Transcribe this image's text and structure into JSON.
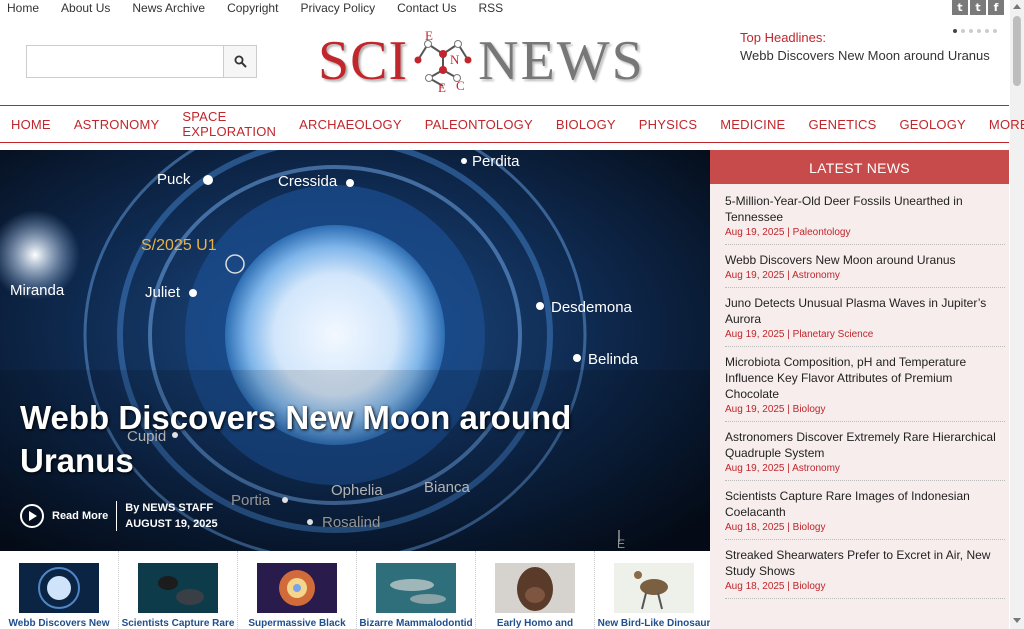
{
  "topbar": {
    "links": [
      "Home",
      "About Us",
      "News Archive",
      "Copyright",
      "Privacy Policy",
      "Contact Us",
      "RSS"
    ],
    "social": [
      {
        "icon": "twitter-icon",
        "glyph": "t"
      },
      {
        "icon": "tumblr-icon",
        "glyph": "t"
      },
      {
        "icon": "facebook-icon",
        "glyph": "f"
      }
    ]
  },
  "search": {
    "placeholder": "",
    "button_icon": "search-icon"
  },
  "logo": {
    "left": "SCI",
    "molecule_letters": [
      "E",
      "N",
      "C",
      "E"
    ],
    "right": "NEWS"
  },
  "headlines": {
    "label": "Top Headlines:",
    "text": "Webb Discovers New Moon around Uranus"
  },
  "nav": [
    "HOME",
    "ASTRONOMY",
    "SPACE EXPLORATION",
    "ARCHAEOLOGY",
    "PALEONTOLOGY",
    "BIOLOGY",
    "PHYSICS",
    "MEDICINE",
    "GENETICS",
    "GEOLOGY",
    "MORE"
  ],
  "hero": {
    "title": "Webb Discovers New Moon around Uranus",
    "read_more": "Read More",
    "byline": "By NEWS STAFF",
    "date": "AUGUST 19, 2025",
    "image_labels": {
      "puck": "Puck",
      "cressida": "Cressida",
      "perdita": "Perdita",
      "new_moon": "S/2025 U1",
      "miranda": "Miranda",
      "juliet": "Juliet",
      "desdemona": "Desdemona",
      "belinda": "Belinda",
      "cupid": "Cupid",
      "ophelia": "Ophelia",
      "bianca": "Bianca",
      "portia": "Portia",
      "rosalind": "Rosalind",
      "compass_e": "E"
    }
  },
  "latest": {
    "heading": "LATEST NEWS",
    "items": [
      {
        "title": "5-Million-Year-Old Deer Fossils Unearthed in Tennessee",
        "meta": "Aug 19, 2025 | Paleontology"
      },
      {
        "title": "Webb Discovers New Moon around Uranus",
        "meta": "Aug 19, 2025 | Astronomy"
      },
      {
        "title": "Juno Detects Unusual Plasma Waves in Jupiter’s Aurora",
        "meta": "Aug 19, 2025 | Planetary Science"
      },
      {
        "title": "Microbiota Composition, pH and Temperature Influence Key Flavor Attributes of Premium Chocolate",
        "meta": "Aug 19, 2025 | Biology"
      },
      {
        "title": "Astronomers Discover Extremely Rare Hierarchical Quadruple System",
        "meta": "Aug 19, 2025 | Astronomy"
      },
      {
        "title": "Scientists Capture Rare Images of Indonesian Coelacanth",
        "meta": "Aug 18, 2025 | Biology"
      },
      {
        "title": "Streaked Shearwaters Prefer to Excret in Air, New Study Shows",
        "meta": "Aug 18, 2025 | Biology"
      }
    ]
  },
  "thumbs": [
    {
      "caption": "Webb Discovers New",
      "kind": "uranus"
    },
    {
      "caption": "Scientists Capture Rare",
      "kind": "diver"
    },
    {
      "caption": "Supermassive Black",
      "kind": "nebula"
    },
    {
      "caption": "Bizarre Mammalodontid",
      "kind": "whale"
    },
    {
      "caption": "Early Homo and",
      "kind": "hominid"
    },
    {
      "caption": "New Bird-Like Dinosaur",
      "kind": "dinosaur"
    }
  ],
  "colors": {
    "accent": "#c0262b",
    "latest_head": "#c84b4b",
    "thumb_caption": "#1f4f8f"
  }
}
